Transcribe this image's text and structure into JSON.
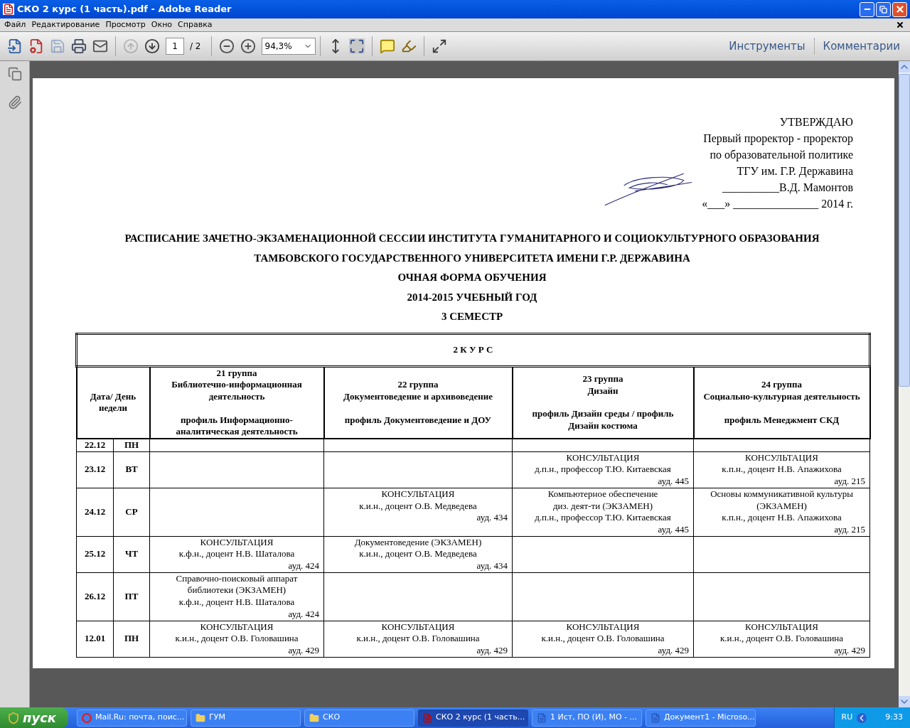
{
  "window": {
    "title": "СКО 2 курс (1 часть).pdf - Adobe Reader"
  },
  "menu": [
    "Файл",
    "Редактирование",
    "Просмотр",
    "Окно",
    "Справка"
  ],
  "toolbar": {
    "page_field": {
      "value": "1"
    },
    "page_total": "/ 2",
    "zoom_field": {
      "value": "94,3%"
    },
    "panels": [
      "Инструменты",
      "Комментарии"
    ]
  },
  "document": {
    "approval": [
      "УТВЕРЖДАЮ",
      "Первый проректор - проректор",
      "по образовательной политике",
      "ТГУ им. Г.Р. Державина",
      "__________В.Д. Мамонтов",
      "«___» _______________ 2014 г."
    ],
    "heading": [
      "РАСПИСАНИЕ ЗАЧЕТНО-ЭКЗАМЕНАЦИОННОЙ СЕССИИ ИНСТИТУТА ГУМАНИТАРНОГО И СОЦИОКУЛЬТУРНОГО ОБРАЗОВАНИЯ",
      "ТАМБОВСКОГО ГОСУДАРСТВЕННОГО УНИВЕРСИТЕТА ИМЕНИ Г.Р. ДЕРЖАВИНА",
      "ОЧНАЯ ФОРМА ОБУЧЕНИЯ",
      "2014-2015 УЧЕБНЫЙ ГОД",
      "3 СЕМЕСТР"
    ],
    "table": {
      "caption": "2 К У Р С",
      "corner": "Дата/ День недели",
      "groups": [
        {
          "lines": [
            "21 группа",
            "Библиотечно-информационная деятельность"
          ],
          "profile": "профиль Информационно-аналитическая деятельность"
        },
        {
          "lines": [
            "22 группа",
            "Документоведение и архивоведение"
          ],
          "profile": "профиль Документоведение и ДОУ"
        },
        {
          "lines": [
            "23 группа",
            "Дизайн"
          ],
          "profile": "профиль Дизайн среды / профиль Дизайн костюма"
        },
        {
          "lines": [
            "24 группа",
            "Социально-культурная деятельность"
          ],
          "profile": "профиль Менеджмент СКД"
        }
      ],
      "rows": [
        {
          "date": "22.12",
          "day": "ПН",
          "cells": [
            null,
            null,
            null,
            null
          ]
        },
        {
          "date": "23.12",
          "day": "ВТ",
          "cells": [
            null,
            null,
            {
              "lines": [
                "КОНСУЛЬТАЦИЯ",
                "д.п.н., профессор Т.Ю. Китаевская"
              ],
              "room": "ауд. 445"
            },
            {
              "lines": [
                "КОНСУЛЬТАЦИЯ",
                "к.п.н., доцент Н.В. Апажихова"
              ],
              "room": "ауд. 215"
            }
          ]
        },
        {
          "date": "24.12",
          "day": "СР",
          "cells": [
            null,
            {
              "lines": [
                "КОНСУЛЬТАЦИЯ",
                "к.и.н., доцент О.В. Медведева"
              ],
              "room": "ауд. 434"
            },
            {
              "lines": [
                "Компьютерное обеспечение",
                "диз. деят-ти (ЭКЗАМЕН)",
                "д.п.н., профессор Т.Ю. Китаевская"
              ],
              "room": "ауд. 445"
            },
            {
              "lines": [
                "Основы коммуникативной культуры",
                "(ЭКЗАМЕН)",
                "к.п.н., доцент Н.В. Апажихова"
              ],
              "room": "ауд. 215"
            }
          ]
        },
        {
          "date": "25.12",
          "day": "ЧТ",
          "cells": [
            {
              "lines": [
                "КОНСУЛЬТАЦИЯ",
                "к.ф.н., доцент Н.В. Шаталова"
              ],
              "room": "ауд. 424"
            },
            {
              "lines": [
                "Документоведение (ЭКЗАМЕН)",
                "к.и.н., доцент О.В. Медведева"
              ],
              "room": "ауд. 434"
            },
            null,
            null
          ]
        },
        {
          "date": "26.12",
          "day": "ПТ",
          "cells": [
            {
              "lines": [
                "Справочно-поисковый аппарат",
                "библиотеки (ЭКЗАМЕН)",
                "к.ф.н., доцент Н.В. Шаталова"
              ],
              "room": "ауд. 424"
            },
            null,
            null,
            null
          ]
        },
        {
          "date": "12.01",
          "day": "ПН",
          "cells": [
            {
              "lines": [
                "КОНСУЛЬТАЦИЯ",
                "к.и.н., доцент О.В. Головашина"
              ],
              "room": "ауд. 429"
            },
            {
              "lines": [
                "КОНСУЛЬТАЦИЯ",
                "к.и.н., доцент О.В. Головашина"
              ],
              "room": "ауд. 429"
            },
            {
              "lines": [
                "КОНСУЛЬТАЦИЯ",
                "к.и.н., доцент О.В. Головашина"
              ],
              "room": "ауд. 429"
            },
            {
              "lines": [
                "КОНСУЛЬТАЦИЯ",
                "к.и.н., доцент О.В. Головашина"
              ],
              "room": "ауд. 429"
            }
          ]
        }
      ]
    }
  },
  "taskbar": {
    "start": "пуск",
    "tasks": [
      {
        "label": "Mail.Ru: почта, поис...",
        "kind": "browser",
        "selected": false
      },
      {
        "label": "ГУМ",
        "kind": "folder",
        "selected": false
      },
      {
        "label": "СКО",
        "kind": "folder",
        "selected": false
      },
      {
        "label": "СКО 2 курс (1 часть...",
        "kind": "pdf",
        "selected": true
      },
      {
        "label": "1 Ист, ПО (И), МО - ...",
        "kind": "word",
        "selected": false
      },
      {
        "label": "Документ1 - Microso...",
        "kind": "word",
        "selected": false
      }
    ],
    "language": "RU",
    "clock": "9:33"
  }
}
